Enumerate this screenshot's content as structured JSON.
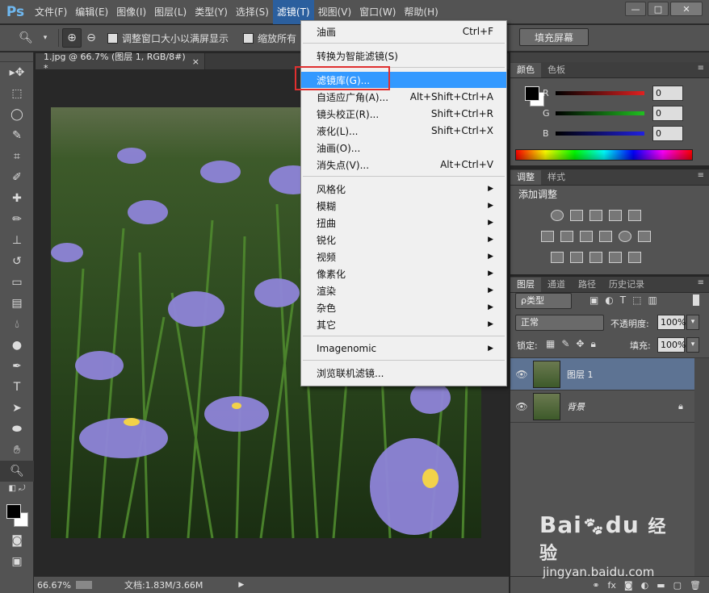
{
  "app": {
    "logo": "Ps"
  },
  "menubar": {
    "items": [
      "文件(F)",
      "编辑(E)",
      "图像(I)",
      "图层(L)",
      "类型(Y)",
      "选择(S)",
      "滤镜(T)",
      "视图(V)",
      "窗口(W)",
      "帮助(H)"
    ],
    "active": "滤镜(T)"
  },
  "window_controls": {
    "minimize": "—",
    "maximize": "□",
    "close": "✕"
  },
  "optionsbar": {
    "fit_window_label": "调整窗口大小以满屏显示",
    "zoom_all_label": "缩放所有",
    "fill_screen_button": "填充屏幕"
  },
  "document": {
    "tab_title": "1.jpg @ 66.7% (图层 1, RGB/8#) *",
    "tab_close": "×"
  },
  "statusbar": {
    "zoom": "66.67%",
    "doc_info": "文档:1.83M/3.66M",
    "arrow": "▶"
  },
  "color_panel": {
    "tabs": [
      "颜色",
      "色板"
    ],
    "channels": [
      {
        "label": "R",
        "value": "0",
        "color": "#e02020"
      },
      {
        "label": "G",
        "value": "0",
        "color": "#20c020"
      },
      {
        "label": "B",
        "value": "0",
        "color": "#2020e0"
      }
    ]
  },
  "adjust_panel": {
    "tabs": [
      "调整",
      "样式"
    ],
    "title": "添加调整"
  },
  "layers_panel": {
    "tabs": [
      "图层",
      "通道",
      "路径",
      "历史记录"
    ],
    "filter_kind": "ρ类型",
    "blend_mode": "正常",
    "opacity_label": "不透明度:",
    "opacity_value": "100%",
    "lock_label": "锁定:",
    "fill_label": "填充:",
    "fill_value": "100%",
    "layers": [
      {
        "name": "图层 1",
        "selected": true,
        "locked": false
      },
      {
        "name": "背景",
        "selected": false,
        "locked": true
      }
    ]
  },
  "filter_menu": {
    "items": [
      {
        "label": "油画",
        "shortcut": "Ctrl+F"
      },
      {
        "label": "转换为智能滤镜(S)",
        "shortcut": ""
      },
      {
        "label": "滤镜库(G)...",
        "shortcut": "",
        "highlighted": true
      },
      {
        "label": "自适应广角(A)...",
        "shortcut": "Alt+Shift+Ctrl+A"
      },
      {
        "label": "镜头校正(R)...",
        "shortcut": "Shift+Ctrl+R"
      },
      {
        "label": "液化(L)...",
        "shortcut": "Shift+Ctrl+X"
      },
      {
        "label": "油画(O)...",
        "shortcut": ""
      },
      {
        "label": "消失点(V)...",
        "shortcut": "Alt+Ctrl+V"
      },
      {
        "label": "风格化",
        "submenu": true
      },
      {
        "label": "模糊",
        "submenu": true
      },
      {
        "label": "扭曲",
        "submenu": true
      },
      {
        "label": "锐化",
        "submenu": true
      },
      {
        "label": "视频",
        "submenu": true
      },
      {
        "label": "像素化",
        "submenu": true
      },
      {
        "label": "渲染",
        "submenu": true
      },
      {
        "label": "杂色",
        "submenu": true
      },
      {
        "label": "其它",
        "submenu": true
      },
      {
        "label": "Imagenomic",
        "submenu": true
      },
      {
        "label": "浏览联机滤镜...",
        "shortcut": ""
      }
    ]
  },
  "watermark": {
    "brand": "Bai",
    "brand2": "du",
    "label": "经验",
    "url": "jingyan.baidu.com"
  }
}
